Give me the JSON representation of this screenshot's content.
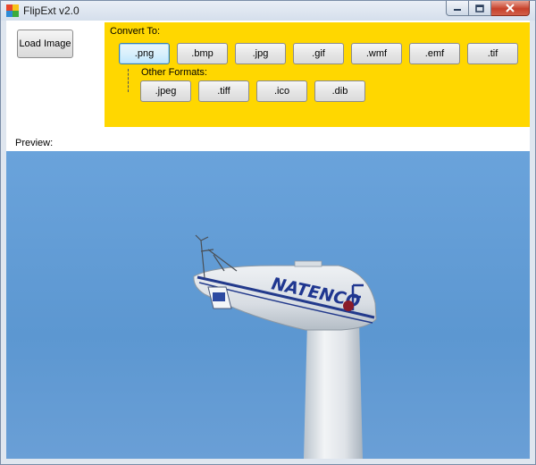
{
  "window": {
    "title": "FlipExt v2.0"
  },
  "toolbar": {
    "load_image_label": "Load Image"
  },
  "convert": {
    "heading": "Convert To:",
    "formats": [
      ".png",
      ".bmp",
      ".jpg",
      ".gif",
      ".wmf",
      ".emf",
      ".tif"
    ],
    "selected": ".png",
    "other_heading": "Other Formats:",
    "other_formats": [
      ".jpeg",
      ".tiff",
      ".ico",
      ".dib"
    ]
  },
  "preview": {
    "label": "Preview:",
    "image_text": "NATENCO"
  },
  "colors": {
    "panel": "#ffd700",
    "sky": "#5f9ad4",
    "close_button": "#c7412b"
  }
}
